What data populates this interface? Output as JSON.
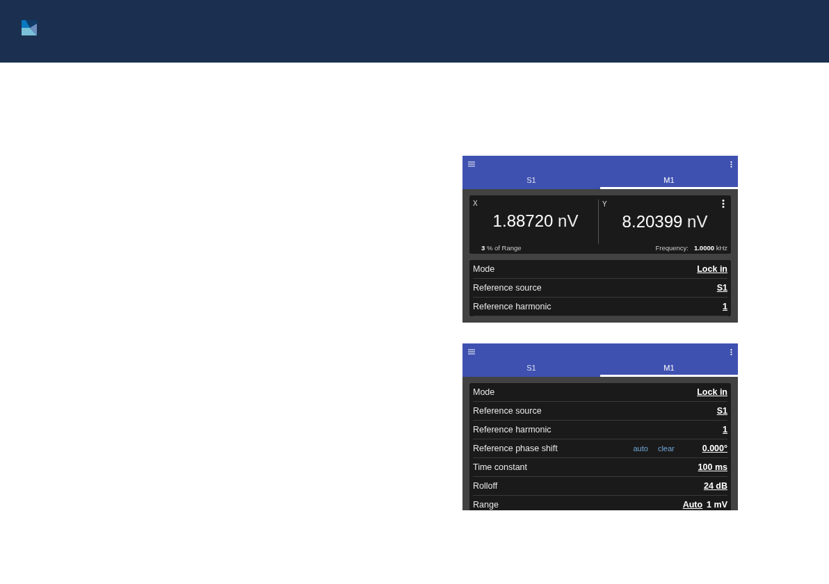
{
  "screens": [
    {
      "tabs": [
        {
          "label": "S1",
          "selected": false
        },
        {
          "label": "M1",
          "selected": true
        }
      ],
      "readout": {
        "channels": [
          {
            "name": "X",
            "value": "1.88720",
            "unit": "nV"
          },
          {
            "name": "Y",
            "value": "8.20399",
            "unit": "nV"
          }
        ],
        "range_value": "3",
        "range_label": "% of Range",
        "frequency_label": "Frequency:",
        "frequency_value": "1.0000",
        "frequency_unit": "kHz"
      },
      "settings": [
        {
          "label": "Mode",
          "values": [
            {
              "text": "Lock in",
              "kind": "link"
            }
          ]
        },
        {
          "label": "Reference source",
          "values": [
            {
              "text": "S1",
              "kind": "link"
            }
          ]
        },
        {
          "label": "Reference harmonic",
          "values": [
            {
              "text": "1",
              "kind": "link"
            }
          ]
        }
      ]
    },
    {
      "tabs": [
        {
          "label": "S1",
          "selected": false
        },
        {
          "label": "M1",
          "selected": true
        }
      ],
      "settings": [
        {
          "label": "Mode",
          "values": [
            {
              "text": "Lock in",
              "kind": "link"
            }
          ]
        },
        {
          "label": "Reference source",
          "values": [
            {
              "text": "S1",
              "kind": "link"
            }
          ]
        },
        {
          "label": "Reference harmonic",
          "values": [
            {
              "text": "1",
              "kind": "link"
            }
          ]
        },
        {
          "label": "Reference phase shift",
          "actions": [
            "auto",
            "clear"
          ],
          "values": [
            {
              "text": "0.000°",
              "kind": "link"
            }
          ]
        },
        {
          "label": "Time constant",
          "values": [
            {
              "text": "100 ms",
              "kind": "link"
            }
          ]
        },
        {
          "label": "Rolloff",
          "values": [
            {
              "text": "24 dB",
              "kind": "link"
            }
          ]
        },
        {
          "label": "Range",
          "values": [
            {
              "text": "Auto",
              "kind": "link"
            },
            {
              "text": "1 mV",
              "kind": "plain"
            }
          ]
        }
      ]
    }
  ]
}
